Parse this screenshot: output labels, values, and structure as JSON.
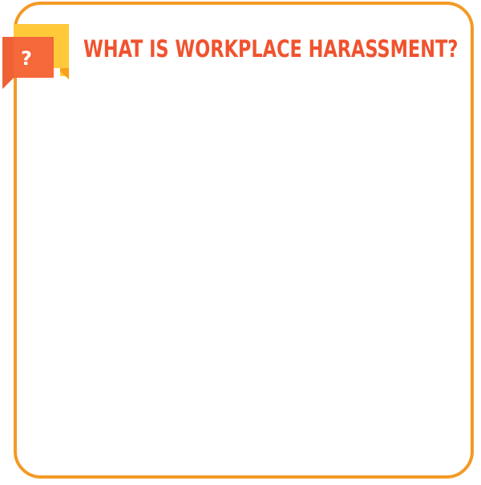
{
  "slide": {
    "title": "WHAT IS WORKPLACE HARASSMENT?",
    "icon": {
      "name": "question-speech-bubble-icon",
      "glyph": "?"
    }
  },
  "colors": {
    "frame_border": "#F39A25",
    "title_text": "#F0532F",
    "bubble_back": "#FFC93A",
    "bubble_back_shade": "#F7A11A",
    "bubble_front": "#F4683A",
    "bubble_front_shade": "#E4572C",
    "glyph": "#FFFFFF"
  }
}
